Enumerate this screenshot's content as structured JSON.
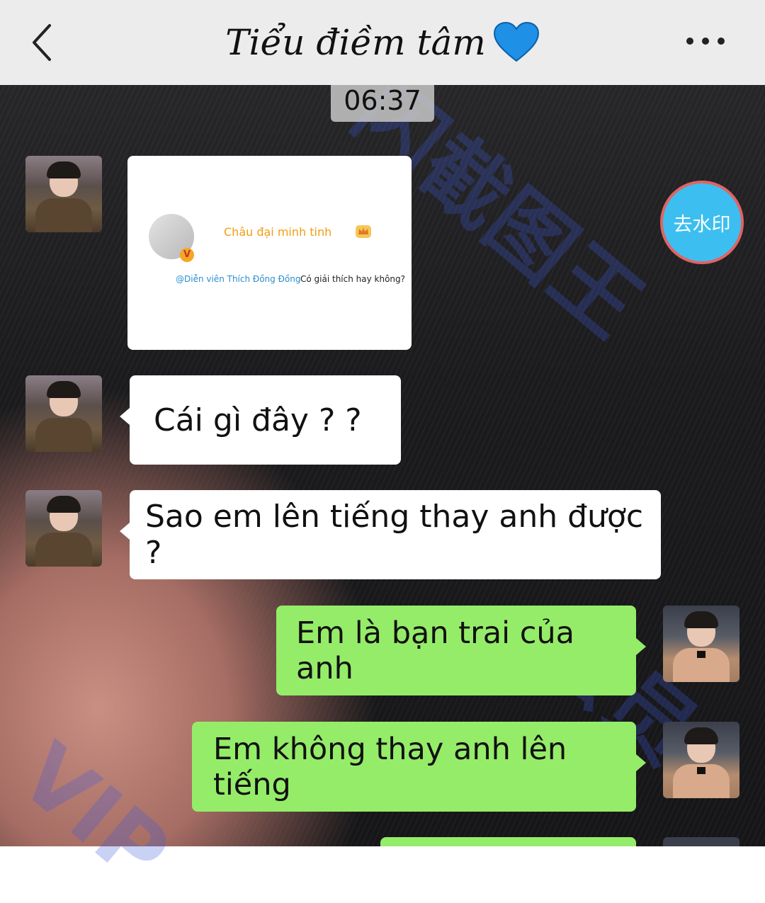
{
  "header": {
    "title": "Tiểu điềm tâm",
    "title_emoji": "💙",
    "back_icon": "chevron-left-icon",
    "more_icon": "more-dots-icon"
  },
  "timestamp": "06:37",
  "watermark": {
    "text_top": "闪截图王",
    "text_right": "会员",
    "text_bottom": "VIP",
    "color": "#3c5adc"
  },
  "shared_card": {
    "name": "Châu đại minh tinh",
    "mention": "@Diễn viên Thích Đồng Đồng",
    "text": "Có giải thích hay không?",
    "verified_badge": "V"
  },
  "remove_watermark_button": {
    "label": "去水印",
    "color": "#3cbff0"
  },
  "messages": [
    {
      "side": "left",
      "text": "Cái gì đây ? ?"
    },
    {
      "side": "left",
      "text": "Sao em lên tiếng thay anh được ?"
    },
    {
      "side": "right",
      "text": "Em là bạn trai của anh"
    },
    {
      "side": "right",
      "text": "Em không thay anh lên tiếng"
    }
  ],
  "colors": {
    "incoming_bubble": "#ffffff",
    "outgoing_bubble": "#95ec69",
    "header_bg": "#ececec"
  }
}
